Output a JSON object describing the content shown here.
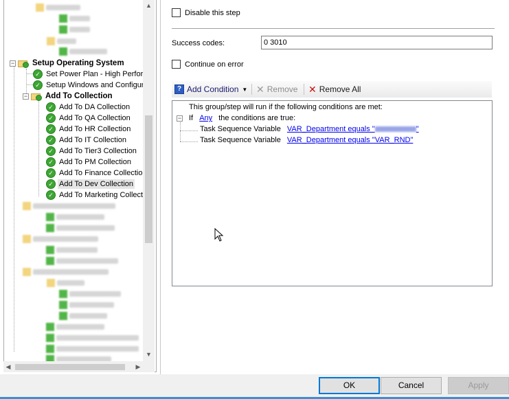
{
  "tree": {
    "visible_items": [
      {
        "label": "Setup Operating System",
        "bold": true
      },
      {
        "label": "Set Power Plan - High Perform"
      },
      {
        "label": "Setup Windows and Configura"
      },
      {
        "label": "Add To Collection",
        "bold": true
      },
      {
        "label": "Add To DA Collection"
      },
      {
        "label": "Add To QA Collection"
      },
      {
        "label": "Add To HR Collection"
      },
      {
        "label": "Add To IT Collection"
      },
      {
        "label": "Add To Tier3 Collection"
      },
      {
        "label": "Add To PM Collection"
      },
      {
        "label": "Add To Finance Collectio"
      },
      {
        "label": "Add To Dev Collection",
        "selected": true
      },
      {
        "label": "Add To Marketing Collecti"
      }
    ],
    "vscroll_up_icon": "scroll-up-arrow",
    "vscroll_down_icon": "scroll-down-arrow",
    "hscroll_left_icon": "scroll-left-arrow",
    "hscroll_right_icon": "scroll-right-arrow"
  },
  "options": {
    "disable_step_label": "Disable this step",
    "success_codes_label": "Success codes:",
    "success_codes_value": "0 3010",
    "continue_on_error_label": "Continue on error"
  },
  "toolbar": {
    "add_condition": "Add Condition",
    "remove": "Remove",
    "remove_all": "Remove All"
  },
  "conditions": {
    "header": "This group/step will run if the following conditions are met:",
    "if_word": "If",
    "any_link": "Any",
    "conditions_true": "the conditions are true:",
    "items": [
      {
        "label": "Task Sequence Variable",
        "link_prefix": "VAR_Department equals \"",
        "link_suffix": "\""
      },
      {
        "label": "Task Sequence Variable",
        "link": "VAR_Department equals \"VAR_RND\""
      }
    ]
  },
  "buttons": {
    "ok": "OK",
    "cancel": "Cancel",
    "apply": "Apply"
  },
  "colors": {
    "accent": "#0078d7",
    "link": "#0000ee",
    "check_green": "#3ea634",
    "remove_red": "#cc1010"
  }
}
